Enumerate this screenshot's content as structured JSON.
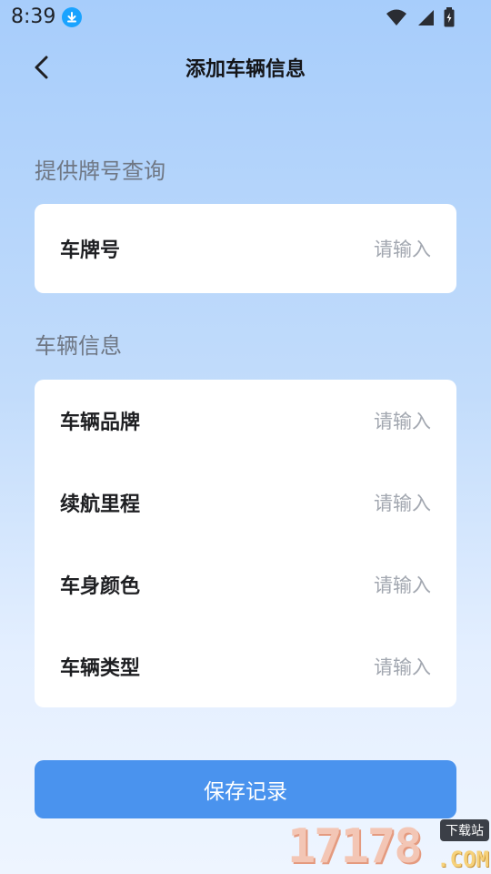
{
  "status_bar": {
    "time": "8:39"
  },
  "header": {
    "title": "添加车辆信息"
  },
  "section_plate": {
    "title": "提供牌号查询",
    "fields": [
      {
        "label": "车牌号",
        "placeholder": "请输入"
      }
    ]
  },
  "section_vehicle": {
    "title": "车辆信息",
    "fields": [
      {
        "label": "车辆品牌",
        "placeholder": "请输入"
      },
      {
        "label": "续航里程",
        "placeholder": "请输入"
      },
      {
        "label": "车身颜色",
        "placeholder": "请输入"
      },
      {
        "label": "车辆类型",
        "placeholder": "请输入"
      }
    ]
  },
  "actions": {
    "save_label": "保存记录"
  },
  "watermark": {
    "number": "17178",
    "tag": "下载站",
    "domain": ".COM"
  },
  "colors": {
    "primary": "#4a93ee",
    "placeholder": "#a2a7b0",
    "section_title": "#6f7784"
  }
}
